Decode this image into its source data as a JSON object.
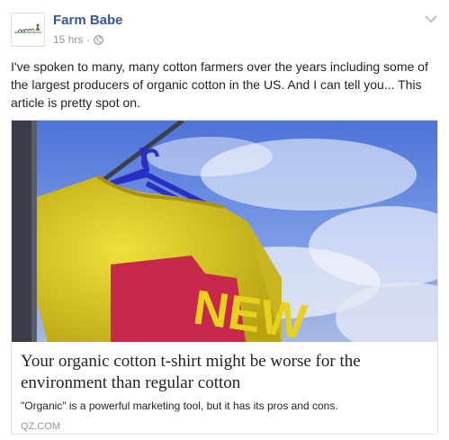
{
  "post": {
    "author": "Farm Babe",
    "time": "15 hrs",
    "separator": "·",
    "privacy_icon": "globe-icon",
    "menu_icon": "chevron-down-icon",
    "avatar_text": "Farm Babe",
    "text": "I've spoken to many, many cotton farmers over the years including some of the largest producers of organic cotton in the US. And I can tell you... This article is pretty spot on."
  },
  "link": {
    "title": "Your organic cotton t-shirt might be worse for the environment than regular cotton",
    "description": "\"Organic\" is a powerful marketing tool, but it has its pros and cons.",
    "domain": "QZ.COM",
    "image_icon": "yellow-tshirt-on-hanger",
    "shirt_print": "NEW"
  },
  "colors": {
    "author_link": "#365899",
    "meta_gray": "#90949c",
    "text": "#1d2129",
    "shirt_yellow": "#e6d21e",
    "hanger_blue": "#2a2fc4",
    "print_red": "#c8284a"
  }
}
